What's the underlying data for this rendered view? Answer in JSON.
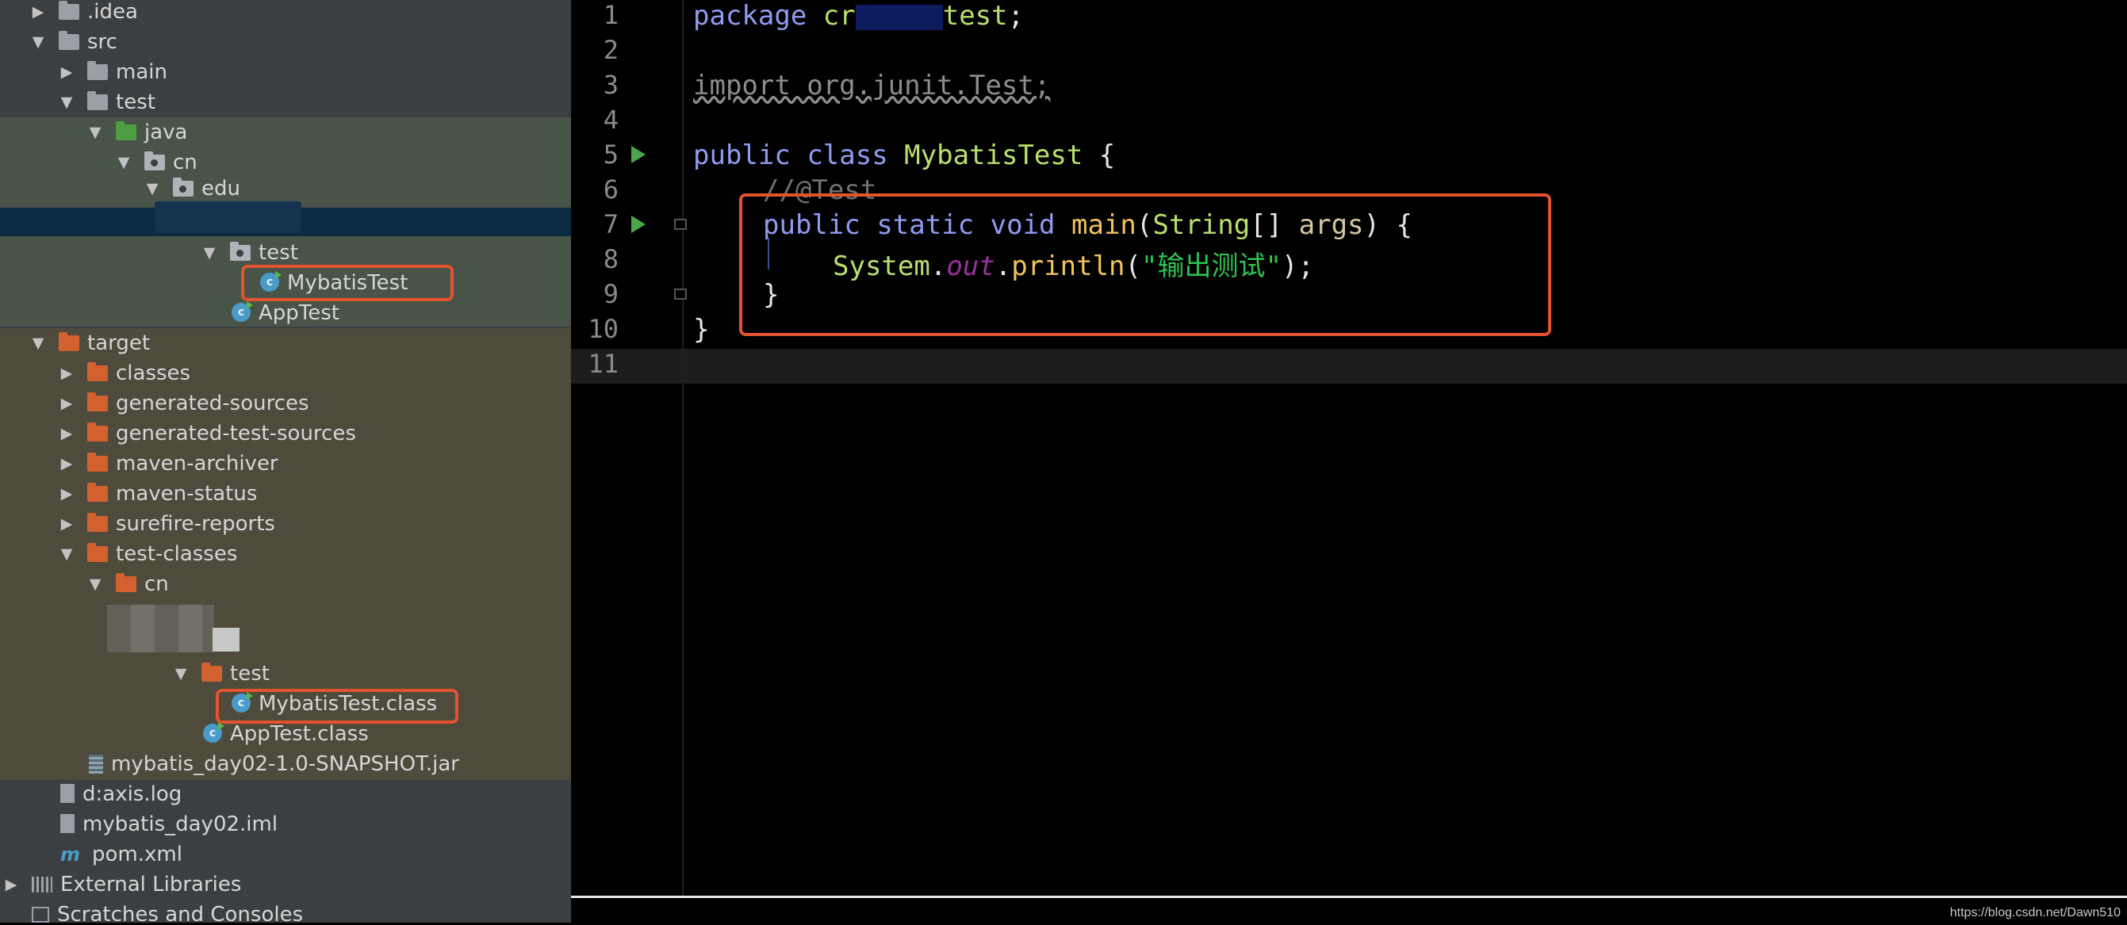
{
  "tree": {
    "items": [
      {
        "label": ".idea",
        "icon": "folder-icon"
      },
      {
        "label": "src",
        "icon": "folder-icon"
      },
      {
        "label": "main",
        "icon": "folder-icon"
      },
      {
        "label": "test",
        "icon": "folder-icon"
      },
      {
        "label": "java",
        "icon": "source-folder-icon"
      },
      {
        "label": "cn",
        "icon": "package-icon"
      },
      {
        "label": "edu",
        "icon": "package-icon"
      },
      {
        "label": "test",
        "icon": "package-icon"
      },
      {
        "label": "MybatisTest",
        "icon": "java-class-icon"
      },
      {
        "label": "AppTest",
        "icon": "java-class-icon"
      },
      {
        "label": "target",
        "icon": "folder-icon"
      },
      {
        "label": "classes",
        "icon": "folder-icon"
      },
      {
        "label": "generated-sources",
        "icon": "folder-icon"
      },
      {
        "label": "generated-test-sources",
        "icon": "folder-icon"
      },
      {
        "label": "maven-archiver",
        "icon": "folder-icon"
      },
      {
        "label": "maven-status",
        "icon": "folder-icon"
      },
      {
        "label": "surefire-reports",
        "icon": "folder-icon"
      },
      {
        "label": "test-classes",
        "icon": "folder-icon"
      },
      {
        "label": "cn",
        "icon": "folder-icon"
      },
      {
        "label": "test",
        "icon": "folder-icon"
      },
      {
        "label": "MybatisTest.class",
        "icon": "class-file-icon"
      },
      {
        "label": "AppTest.class",
        "icon": "class-file-icon"
      },
      {
        "label": "mybatis_day02-1.0-SNAPSHOT.jar",
        "icon": "jar-icon"
      },
      {
        "label": "d:axis.log",
        "icon": "text-file-icon"
      },
      {
        "label": "mybatis_day02.iml",
        "icon": "module-file-icon"
      },
      {
        "label": "pom.xml",
        "icon": "maven-icon"
      },
      {
        "label": "External Libraries",
        "icon": "libraries-icon"
      },
      {
        "label": "Scratches and Consoles",
        "icon": "scratches-icon"
      }
    ]
  },
  "editor": {
    "line_numbers": [
      "1",
      "2",
      "3",
      "4",
      "5",
      "6",
      "7",
      "8",
      "9",
      "10",
      "11"
    ],
    "code": {
      "l1_kw": "package",
      "l1_pre": " cr",
      "l1_post": "test",
      "l1_semi": ";",
      "l3": "import org.junit.Test;",
      "l5_kw1": "public",
      "l5_kw2": "class",
      "l5_name": "MybatisTest",
      "l5_brace": " {",
      "l6": "//@Test",
      "l7_kw1": "public",
      "l7_kw2": "static",
      "l7_kw3": "void",
      "l7_meth": "main",
      "l7_p1": "(",
      "l7_type": "String",
      "l7_p2": "[] ",
      "l7_arg": "args",
      "l7_p3": ") {",
      "l8_obj": "System",
      "l8_dot1": ".",
      "l8_field": "out",
      "l8_dot2": ".",
      "l8_meth": "println",
      "l8_p1": "(",
      "l8_str": "\"输出测试\"",
      "l8_p2": ");",
      "l9": "}",
      "l10": "}"
    }
  },
  "watermark": "https://blog.csdn.net/Dawn510",
  "colors": {
    "highlight": "#e3532d",
    "tree_bg": "#3c3f41",
    "editor_bg": "#000000"
  }
}
